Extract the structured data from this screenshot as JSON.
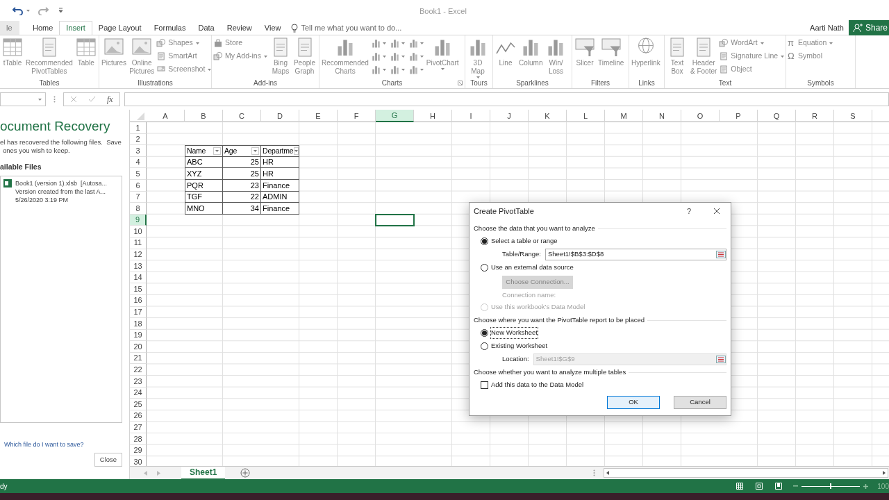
{
  "window": {
    "title": "Book1 - Excel"
  },
  "tabs": [
    {
      "label": "le",
      "selected": false
    },
    {
      "label": "Home",
      "selected": false
    },
    {
      "label": "Insert",
      "selected": true
    },
    {
      "label": "Page Layout",
      "selected": false
    },
    {
      "label": "Formulas",
      "selected": false
    },
    {
      "label": "Data",
      "selected": false
    },
    {
      "label": "Review",
      "selected": false
    },
    {
      "label": "View",
      "selected": false
    }
  ],
  "tell_me": {
    "placeholder": "Tell me what you want to do..."
  },
  "user": "Aarti Nath",
  "share": "Share",
  "ribbon": [
    {
      "label": "Tables",
      "items": [
        {
          "kind": "large",
          "lines": [
            "tTable"
          ]
        },
        {
          "kind": "large",
          "lines": [
            "Recommended",
            "PivotTables"
          ]
        },
        {
          "kind": "large",
          "lines": [
            "Table"
          ]
        }
      ]
    },
    {
      "label": "Illustrations",
      "items": [
        {
          "kind": "large",
          "lines": [
            "Pictures"
          ]
        },
        {
          "kind": "large",
          "lines": [
            "Online",
            "Pictures"
          ]
        },
        {
          "kind": "small",
          "label": "Shapes",
          "dropdown": true
        },
        {
          "kind": "small",
          "label": "SmartArt",
          "dropdown": false
        },
        {
          "kind": "small",
          "label": "Screenshot",
          "dropdown": true
        }
      ]
    },
    {
      "label": "Add-ins",
      "items": [
        {
          "kind": "small",
          "label": "Store",
          "dropdown": false
        },
        {
          "kind": "small",
          "label": "My Add-ins",
          "dropdown": true
        },
        {
          "kind": "large",
          "lines": [
            "Bing",
            "Maps"
          ]
        },
        {
          "kind": "large",
          "lines": [
            "People",
            "Graph"
          ]
        }
      ]
    },
    {
      "label": "Charts",
      "launcher": true,
      "items": [
        {
          "kind": "large",
          "lines": [
            "Recommended",
            "Charts"
          ]
        },
        {
          "kind": "mini"
        },
        {
          "kind": "mini"
        },
        {
          "kind": "mini"
        },
        {
          "kind": "mini"
        },
        {
          "kind": "mini"
        },
        {
          "kind": "mini"
        },
        {
          "kind": "mini"
        },
        {
          "kind": "mini"
        },
        {
          "kind": "mini"
        },
        {
          "kind": "large",
          "lines": [
            "PivotChart"
          ],
          "dropdown": true
        }
      ]
    },
    {
      "label": "Tours",
      "items": [
        {
          "kind": "large",
          "lines": [
            "3D",
            "Map"
          ],
          "dropdown": true
        }
      ]
    },
    {
      "label": "Sparklines",
      "items": [
        {
          "kind": "large",
          "lines": [
            "Line"
          ]
        },
        {
          "kind": "large",
          "lines": [
            "Column"
          ]
        },
        {
          "kind": "large",
          "lines": [
            "Win/",
            "Loss"
          ]
        }
      ]
    },
    {
      "label": "Filters",
      "items": [
        {
          "kind": "large",
          "lines": [
            "Slicer"
          ]
        },
        {
          "kind": "large",
          "lines": [
            "Timeline"
          ]
        }
      ]
    },
    {
      "label": "Links",
      "items": [
        {
          "kind": "large",
          "lines": [
            "Hyperlink"
          ]
        }
      ]
    },
    {
      "label": "Text",
      "items": [
        {
          "kind": "large",
          "lines": [
            "Text",
            "Box"
          ]
        },
        {
          "kind": "large",
          "lines": [
            "Header",
            "& Footer"
          ]
        },
        {
          "kind": "small",
          "label": "WordArt",
          "dropdown": true
        },
        {
          "kind": "small",
          "label": "Signature Line",
          "dropdown": true
        },
        {
          "kind": "small",
          "label": "Object",
          "dropdown": false
        }
      ]
    },
    {
      "label": "Symbols",
      "items": [
        {
          "kind": "small",
          "label": "Equation",
          "glyph": "π",
          "dropdown": true
        },
        {
          "kind": "small",
          "label": "Symbol",
          "glyph": "Ω",
          "dropdown": false
        }
      ]
    }
  ],
  "formula_bar": {
    "fx": "fx"
  },
  "recovery": {
    "title": "ocument Recovery",
    "intro": [
      "el has recovered the following files.  Save",
      "ones you wish to keep."
    ],
    "heading": "ailable Files",
    "files": [
      {
        "lines": [
          "Book1 (version 1).xlsb  [Autosa...",
          "Version created from the last A...",
          "5/26/2020 3:19 PM"
        ]
      }
    ],
    "help_link": "Which file do I want to save?",
    "close": "Close"
  },
  "sheet": {
    "columns": [
      {
        "label": "A",
        "selected": false
      },
      {
        "label": "B",
        "selected": false
      },
      {
        "label": "C",
        "selected": false
      },
      {
        "label": "D",
        "selected": false
      },
      {
        "label": "E",
        "selected": false
      },
      {
        "label": "F",
        "selected": false
      },
      {
        "label": "G",
        "selected": true
      },
      {
        "label": "H",
        "selected": false
      },
      {
        "label": "I",
        "selected": false
      },
      {
        "label": "J",
        "selected": false
      },
      {
        "label": "K",
        "selected": false
      },
      {
        "label": "L",
        "selected": false
      },
      {
        "label": "M",
        "selected": false
      },
      {
        "label": "N",
        "selected": false
      },
      {
        "label": "O",
        "selected": false
      },
      {
        "label": "P",
        "selected": false
      },
      {
        "label": "Q",
        "selected": false
      },
      {
        "label": "R",
        "selected": false
      },
      {
        "label": "S",
        "selected": false
      }
    ],
    "rows": [
      {
        "label": "1",
        "selected": false
      },
      {
        "label": "2",
        "selected": false
      },
      {
        "label": "3",
        "selected": false
      },
      {
        "label": "4",
        "selected": false
      },
      {
        "label": "5",
        "selected": false
      },
      {
        "label": "6",
        "selected": false
      },
      {
        "label": "7",
        "selected": false
      },
      {
        "label": "8",
        "selected": false
      },
      {
        "label": "9",
        "selected": true
      },
      {
        "label": "10",
        "selected": false
      },
      {
        "label": "11",
        "selected": false
      },
      {
        "label": "12",
        "selected": false
      },
      {
        "label": "13",
        "selected": false
      },
      {
        "label": "14",
        "selected": false
      },
      {
        "label": "15",
        "selected": false
      },
      {
        "label": "16",
        "selected": false
      },
      {
        "label": "17",
        "selected": false
      },
      {
        "label": "18",
        "selected": false
      },
      {
        "label": "19",
        "selected": false
      },
      {
        "label": "20",
        "selected": false
      },
      {
        "label": "21",
        "selected": false
      },
      {
        "label": "22",
        "selected": false
      },
      {
        "label": "23",
        "selected": false
      },
      {
        "label": "24",
        "selected": false
      },
      {
        "label": "25",
        "selected": false
      },
      {
        "label": "26",
        "selected": false
      },
      {
        "label": "27",
        "selected": false
      },
      {
        "label": "28",
        "selected": false
      },
      {
        "label": "29",
        "selected": false
      },
      {
        "label": "30",
        "selected": false
      }
    ],
    "table": {
      "header": [
        {
          "label": "Name",
          "kind": "text"
        },
        {
          "label": "Age",
          "kind": "number"
        },
        {
          "label": "Departme",
          "kind": "text"
        }
      ],
      "rows": [
        [
          "ABC",
          "25",
          "HR"
        ],
        [
          "XYZ",
          "25",
          "HR"
        ],
        [
          "PQR",
          "23",
          "Finance"
        ],
        [
          "TGF",
          "22",
          "ADMIN"
        ],
        [
          "MNO",
          "34",
          "Finance"
        ]
      ]
    }
  },
  "sheet_tabs": [
    {
      "label": "Sheet1",
      "selected": true
    }
  ],
  "status": {
    "text": "dy",
    "zoom": "100",
    "zoom_slider": {
      "level": 0.5
    }
  },
  "dialog": {
    "title": "Create PivotTable",
    "help": "?",
    "items": [
      {
        "kind": "section",
        "label": "Choose the data that you want to analyze"
      },
      {
        "kind": "radio",
        "label": "Select a table or range",
        "selected": true,
        "disabled": false
      },
      {
        "kind": "field",
        "label": "Table/Range:",
        "value": "Sheet1!$B$3:$D$8",
        "disabled": false
      },
      {
        "kind": "radio",
        "label": "Use an external data source",
        "selected": false,
        "disabled": false
      },
      {
        "kind": "button",
        "label": "Choose Connection...",
        "disabled": true
      },
      {
        "kind": "note",
        "label": "Connection name:",
        "disabled": true
      },
      {
        "kind": "radio",
        "label": "Use this workbook's Data Model",
        "selected": false,
        "disabled": true
      },
      {
        "kind": "section",
        "label": "Choose where you want the PivotTable report to be placed"
      },
      {
        "kind": "radio",
        "label": "New Worksheet",
        "selected": true,
        "disabled": false
      },
      {
        "kind": "radio",
        "label": "Existing Worksheet",
        "selected": false,
        "disabled": false
      },
      {
        "kind": "field",
        "label": "Location:",
        "value": "Sheet1!$G$9",
        "disabled": true
      },
      {
        "kind": "section",
        "label": "Choose whether you want to analyze multiple tables"
      },
      {
        "kind": "checkbox",
        "label": "Add this data to the Data Model",
        "checked": false
      }
    ],
    "buttons": [
      {
        "label": "OK",
        "default": true
      },
      {
        "label": "Cancel",
        "default": false
      }
    ]
  }
}
